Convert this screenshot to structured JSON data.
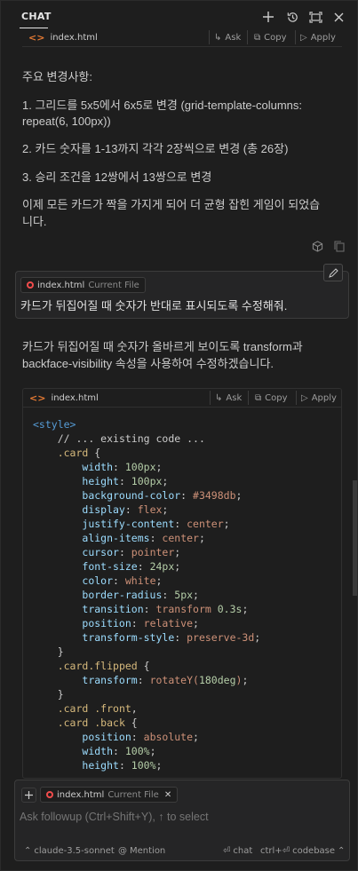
{
  "header": {
    "title": "CHAT"
  },
  "top_code_bar": {
    "file": "index.html",
    "ask": "Ask",
    "copy": "Copy",
    "apply": "Apply"
  },
  "assistant1": {
    "heading": "주요 변경사항:",
    "items": [
      "1. 그리드를 5x5에서 6x5로 변경 (grid-template-columns:",
      "repeat(6, 100px))",
      "2. 카드 숫자를 1-13까지 각각 2장씩으로 변경 (총 26장)",
      "3. 승리 조건을 12쌍에서 13쌍으로 변경"
    ],
    "summary_line1": "이제 모든 카드가 짝을 가지게 되어 더 균형 잡힌 게임이 되었습",
    "summary_line2": "니다."
  },
  "user_message": {
    "chip_file": "index.html",
    "chip_sub": "Current File",
    "text": "카드가 뒤집어질 때 숫자가 반대로 표시되도록 수정해줘."
  },
  "assistant2": {
    "line1": "카드가 뒤집어질 때 숫자가 올바르게 보이도록 transform과",
    "line2": "backface-visibility 속성을 사용하여 수정하겠습니다."
  },
  "code_block": {
    "file": "index.html",
    "ask": "Ask",
    "copy": "Copy",
    "apply": "Apply",
    "lines": [
      {
        "indent": 0,
        "parts": [
          [
            "tag",
            "<style>"
          ]
        ]
      },
      {
        "indent": 1,
        "parts": [
          [
            "cm",
            "// ... existing code ..."
          ]
        ]
      },
      {
        "indent": 1,
        "parts": [
          [
            "sel",
            ".card"
          ],
          [
            "pun",
            " {"
          ]
        ]
      },
      {
        "indent": 2,
        "parts": [
          [
            "prop",
            "width"
          ],
          [
            "pun",
            ": "
          ],
          [
            "num",
            "100px"
          ],
          [
            "pun",
            ";"
          ]
        ]
      },
      {
        "indent": 2,
        "parts": [
          [
            "prop",
            "height"
          ],
          [
            "pun",
            ": "
          ],
          [
            "num",
            "100px"
          ],
          [
            "pun",
            ";"
          ]
        ]
      },
      {
        "indent": 2,
        "parts": [
          [
            "prop",
            "background-color"
          ],
          [
            "pun",
            ": "
          ],
          [
            "val",
            "#3498db"
          ],
          [
            "pun",
            ";"
          ]
        ]
      },
      {
        "indent": 2,
        "parts": [
          [
            "prop",
            "display"
          ],
          [
            "pun",
            ": "
          ],
          [
            "val",
            "flex"
          ],
          [
            "pun",
            ";"
          ]
        ]
      },
      {
        "indent": 2,
        "parts": [
          [
            "prop",
            "justify-content"
          ],
          [
            "pun",
            ": "
          ],
          [
            "val",
            "center"
          ],
          [
            "pun",
            ";"
          ]
        ]
      },
      {
        "indent": 2,
        "parts": [
          [
            "prop",
            "align-items"
          ],
          [
            "pun",
            ": "
          ],
          [
            "val",
            "center"
          ],
          [
            "pun",
            ";"
          ]
        ]
      },
      {
        "indent": 2,
        "parts": [
          [
            "prop",
            "cursor"
          ],
          [
            "pun",
            ": "
          ],
          [
            "val",
            "pointer"
          ],
          [
            "pun",
            ";"
          ]
        ]
      },
      {
        "indent": 2,
        "parts": [
          [
            "prop",
            "font-size"
          ],
          [
            "pun",
            ": "
          ],
          [
            "num",
            "24px"
          ],
          [
            "pun",
            ";"
          ]
        ]
      },
      {
        "indent": 2,
        "parts": [
          [
            "prop",
            "color"
          ],
          [
            "pun",
            ": "
          ],
          [
            "val",
            "white"
          ],
          [
            "pun",
            ";"
          ]
        ]
      },
      {
        "indent": 2,
        "parts": [
          [
            "prop",
            "border-radius"
          ],
          [
            "pun",
            ": "
          ],
          [
            "num",
            "5px"
          ],
          [
            "pun",
            ";"
          ]
        ]
      },
      {
        "indent": 2,
        "parts": [
          [
            "prop",
            "transition"
          ],
          [
            "pun",
            ": "
          ],
          [
            "val",
            "transform "
          ],
          [
            "num",
            "0.3s"
          ],
          [
            "pun",
            ";"
          ]
        ]
      },
      {
        "indent": 2,
        "parts": [
          [
            "prop",
            "position"
          ],
          [
            "pun",
            ": "
          ],
          [
            "val",
            "relative"
          ],
          [
            "pun",
            ";"
          ]
        ]
      },
      {
        "indent": 2,
        "parts": [
          [
            "prop",
            "transform-style"
          ],
          [
            "pun",
            ": "
          ],
          [
            "val",
            "preserve-3d"
          ],
          [
            "pun",
            ";"
          ]
        ]
      },
      {
        "indent": 1,
        "parts": [
          [
            "pun",
            "}"
          ]
        ]
      },
      {
        "indent": 1,
        "parts": [
          [
            "sel",
            ".card.flipped"
          ],
          [
            "pun",
            " {"
          ]
        ]
      },
      {
        "indent": 2,
        "parts": [
          [
            "prop",
            "transform"
          ],
          [
            "pun",
            ": "
          ],
          [
            "val",
            "rotateY("
          ],
          [
            "num",
            "180deg"
          ],
          [
            "val",
            ")"
          ],
          [
            "pun",
            ";"
          ]
        ]
      },
      {
        "indent": 1,
        "parts": [
          [
            "pun",
            "}"
          ]
        ]
      },
      {
        "indent": 1,
        "parts": [
          [
            "sel",
            ".card .front"
          ],
          [
            "pun",
            ","
          ]
        ]
      },
      {
        "indent": 1,
        "parts": [
          [
            "sel",
            ".card .back"
          ],
          [
            "pun",
            " {"
          ]
        ]
      },
      {
        "indent": 2,
        "parts": [
          [
            "prop",
            "position"
          ],
          [
            "pun",
            ": "
          ],
          [
            "val",
            "absolute"
          ],
          [
            "pun",
            ";"
          ]
        ]
      },
      {
        "indent": 2,
        "parts": [
          [
            "prop",
            "width"
          ],
          [
            "pun",
            ": "
          ],
          [
            "num",
            "100%"
          ],
          [
            "pun",
            ";"
          ]
        ]
      },
      {
        "indent": 2,
        "parts": [
          [
            "prop",
            "height"
          ],
          [
            "pun",
            ": "
          ],
          [
            "num",
            "100%"
          ],
          [
            "pun",
            ";"
          ]
        ]
      }
    ]
  },
  "input": {
    "chip_file": "index.html",
    "chip_sub": "Current File",
    "placeholder": "Ask followup (Ctrl+Shift+Y), ↑ to select",
    "model": "claude-3.5-sonnet",
    "mention": "Mention",
    "chat": "chat",
    "codebase_shortcut": "ctrl+⏎",
    "codebase": "codebase"
  },
  "colors": {
    "background": "#1e1e1e",
    "accent_tag": "#e37933",
    "keyword": "#569cd6",
    "selector": "#d7ba7d",
    "property": "#9cdcfe",
    "string": "#ce9178",
    "number": "#b5cea8"
  },
  "icons": [
    "plus-icon",
    "history-icon",
    "maximize-icon",
    "close-icon",
    "cube-icon",
    "copy-icon",
    "edit-icon",
    "file-icon"
  ]
}
